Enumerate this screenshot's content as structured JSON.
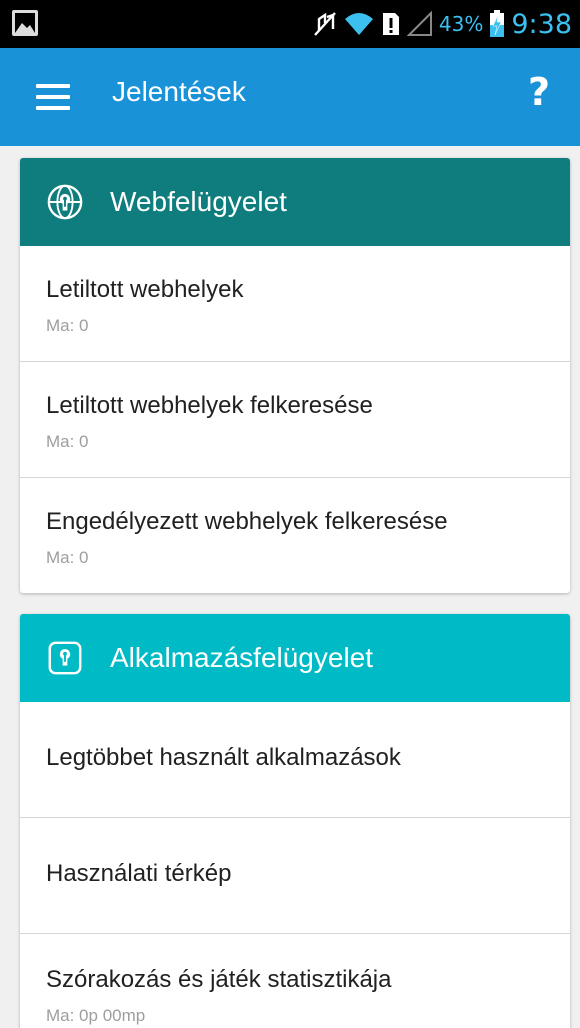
{
  "status_bar": {
    "battery_percent": "43%",
    "time": "9:38",
    "accent": "#3bc0f0"
  },
  "app_bar": {
    "title": "Jelentések",
    "help_label": "?",
    "background": "#1a92d8"
  },
  "sections": [
    {
      "title": "Webfelügyelet",
      "icon": "globe-keyhole-icon",
      "color": "#0f7d7d",
      "items": [
        {
          "title": "Letiltott webhelyek",
          "subtitle": "Ma: 0"
        },
        {
          "title": "Letiltott webhelyek felkeresése",
          "subtitle": "Ma: 0"
        },
        {
          "title": "Engedélyezett webhelyek felkeresése",
          "subtitle": "Ma: 0"
        }
      ]
    },
    {
      "title": "Alkalmazásfelügyelet",
      "icon": "app-lock-icon",
      "color": "#00bac6",
      "items": [
        {
          "title": "Legtöbbet használt alkalmazások"
        },
        {
          "title": "Használati térkép"
        },
        {
          "title": "Szórakozás és játék statisztikája",
          "subtitle": "Ma: 0p 00mp"
        }
      ]
    }
  ]
}
